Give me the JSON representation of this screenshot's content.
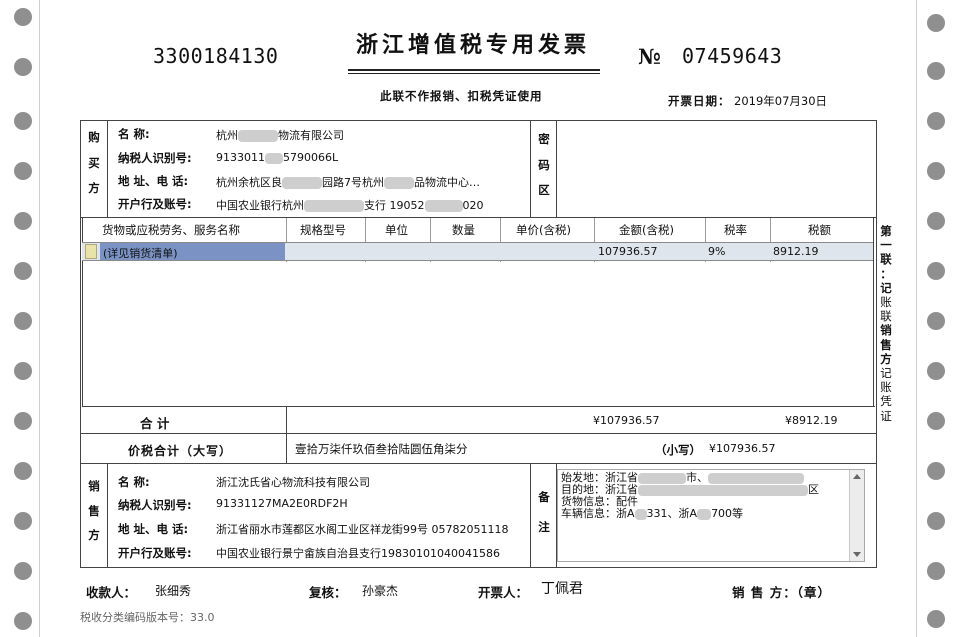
{
  "invoice": {
    "code": "3300184130",
    "title": "浙江增值税专用发票",
    "no_symbol": "№",
    "number": "07459643",
    "subtitle": "此联不作报销、扣税凭证使用",
    "date_label": "开票日期：",
    "date": "2019年07月30日"
  },
  "buyer": {
    "section_label": [
      "购",
      "买",
      "方"
    ],
    "name_label": "名        称:",
    "name": "杭州",
    "name_suffix": "物流有限公司",
    "tax_id_label": "纳税人识别号:",
    "tax_id_prefix": "9133011",
    "tax_id_suffix": "5790066L",
    "address_label": "地 址、电 话:",
    "address_prefix": "杭州余杭区良",
    "address_mid": "园路7号杭州",
    "address_suffix": "品物流中心…",
    "bank_label": "开户行及账号:",
    "bank_prefix": "中国农业银行杭州",
    "bank_mid": "支行 19052",
    "bank_suffix": "020"
  },
  "cipher": {
    "label": [
      "密",
      "码",
      "区"
    ]
  },
  "items": {
    "headers": [
      "货物或应税劳务、服务名称",
      "规格型号",
      "单位",
      "数量",
      "单价(含税)",
      "金额(含税)",
      "税率",
      "税额"
    ],
    "rows": [
      {
        "name": "(详见销货清单)",
        "spec": "",
        "unit": "",
        "qty": "",
        "price": "",
        "amount": "107936.57",
        "rate": "9%",
        "tax": "8912.19"
      }
    ]
  },
  "totals": {
    "label": "合            计",
    "amount": "¥107936.57",
    "tax": "¥8912.19",
    "grand_label": "价税合计（大写）",
    "grand_words": "壹拾万柒仟玖佰叁拾陆圆伍角柒分",
    "small_label": "（小写）",
    "grand_amount": "¥107936.57"
  },
  "seller": {
    "section_label": [
      "销",
      "售",
      "方"
    ],
    "name_label": "名        称:",
    "name": "浙江沈氏省心物流科技有限公司",
    "tax_id_label": "纳税人识别号:",
    "tax_id": "91331127MA2E0RDF2H",
    "address_label": "地 址、电 话:",
    "address": "浙江省丽水市莲都区水阁工业区祥龙街99号 05782051118",
    "bank_label": "开户行及账号:",
    "bank": "中国农业银行景宁畲族自治县支行19830101040041586"
  },
  "remarks": {
    "label": [
      "备",
      "注"
    ],
    "line1_prefix": "始发地：浙江省",
    "line1_mid": "市、",
    "line2_prefix": "目的地：浙江省",
    "line2_suffix": "区",
    "line3": "货物信息：配件",
    "line4_prefix": "车辆信息：浙A",
    "line4_mid": "331、浙A",
    "line4_suffix": "700等"
  },
  "side_copy": {
    "chars": [
      "第",
      "一",
      "联",
      "：",
      "记",
      "账",
      "联",
      " ",
      "销",
      "售",
      "方",
      "记",
      "账",
      "凭",
      "证"
    ]
  },
  "footer": {
    "payee_label": "收款人：",
    "payee": "张细秀",
    "reviewer_label": "复核：",
    "reviewer": "孙豪杰",
    "drawer_label": "开票人：",
    "drawer": "丁佩君",
    "seller_label": "销 售 方：（章）",
    "version": "税收分类编码版本号：33.0"
  }
}
